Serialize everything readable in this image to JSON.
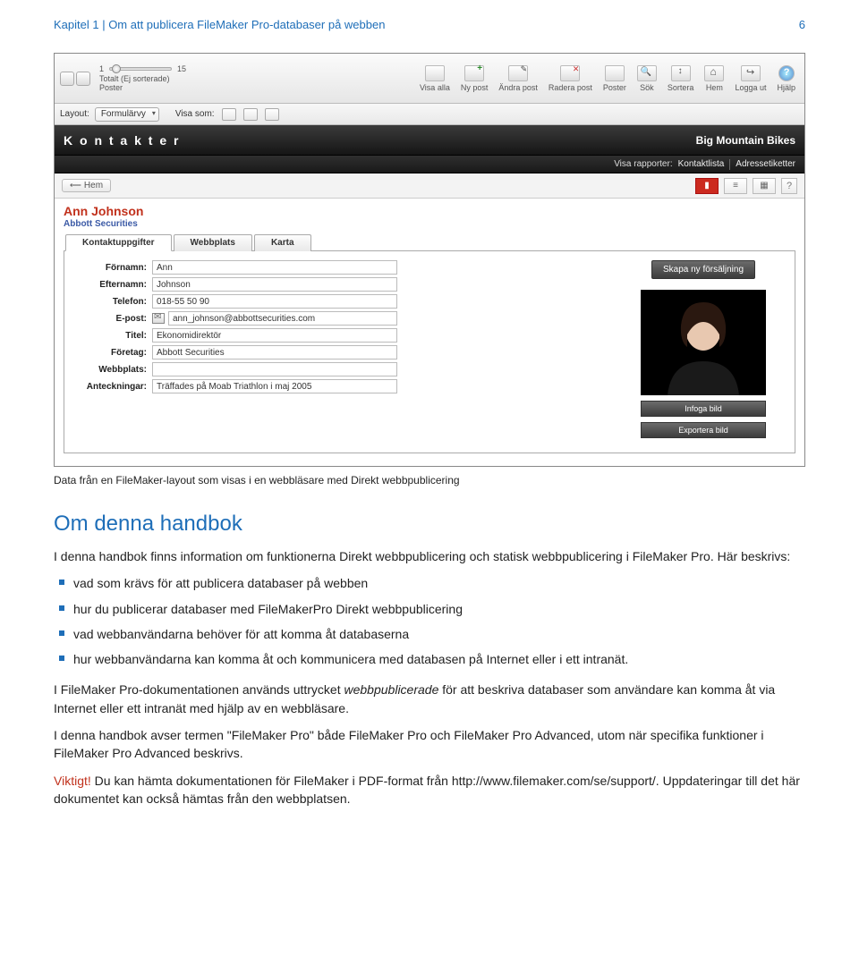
{
  "page_header": {
    "left": "Kapitel 1  |  Om att publicera FileMaker Pro-databaser på webben",
    "right": "6"
  },
  "screenshot": {
    "toolbar": {
      "record_current": "1",
      "record_total": "15",
      "sort_status": "Totalt (Ej sorterade)",
      "posts_label": "Poster",
      "actions": {
        "visa_alla": "Visa alla",
        "ny_post": "Ny post",
        "andra_post": "Ändra post",
        "radera_post": "Radera post",
        "poster": "Poster",
        "sok": "Sök",
        "sortera": "Sortera",
        "hem": "Hem",
        "logga_ut": "Logga ut",
        "hjalp": "Hjälp"
      },
      "layout_label": "Layout:",
      "layout_value": "Formulärvy",
      "visa_som_label": "Visa som:"
    },
    "blackbar": {
      "title": "K o n t a k t e r",
      "company": "Big Mountain Bikes",
      "reports_label": "Visa rapporter:",
      "report1": "Kontaktlista",
      "report2": "Adressetiketter"
    },
    "subheader": {
      "home": "Hem"
    },
    "record": {
      "name": "Ann Johnson",
      "company": "Abbott Securities",
      "tabs": {
        "kontakt": "Kontaktuppgifter",
        "webb": "Webbplats",
        "karta": "Karta"
      },
      "fields": {
        "fornamn_label": "Förnamn:",
        "fornamn": "Ann",
        "efternamn_label": "Efternamn:",
        "efternamn": "Johnson",
        "telefon_label": "Telefon:",
        "telefon": "018-55 50 90",
        "epost_label": "E-post:",
        "epost": "ann_johnson@abbottsecurities.com",
        "titel_label": "Titel:",
        "titel": "Ekonomidirektör",
        "foretag_label": "Företag:",
        "foretag": "Abbott Securities",
        "webb_label": "Webbplats:",
        "webb": "",
        "anteck_label": "Anteckningar:",
        "anteck": "Träffades på Moab Triathlon i maj 2005"
      },
      "buttons": {
        "skapa": "Skapa ny försäljning",
        "infoga": "Infoga bild",
        "export": "Exportera bild"
      }
    }
  },
  "caption": "Data från en FileMaker-layout som visas i en webbläsare med Direkt webbpublicering",
  "section_heading": "Om denna handbok",
  "para1": "I denna handbok finns information om funktionerna Direkt webbpublicering och statisk webbpublicering i FileMaker Pro. Här beskrivs:",
  "bullets": {
    "b1": "vad som krävs för att publicera databaser på webben",
    "b2": "hur du publicerar databaser med FileMakerPro Direkt webbpublicering",
    "b3": "vad webbanvändarna behöver för att komma åt databaserna",
    "b4": "hur webbanvändarna kan komma åt och kommunicera med databasen på Internet eller i ett intranät."
  },
  "para2a": "I FileMaker Pro-dokumentationen används uttrycket ",
  "para2_term": "webbpublicerade",
  "para2b": " för att beskriva databaser som användare kan komma åt via Internet eller ett intranät med hjälp av en webbläsare.",
  "para3": "I denna handbok avser termen \"FileMaker Pro\" både FileMaker Pro och FileMaker Pro Advanced, utom när specifika funktioner i FileMaker Pro Advanced beskrivs.",
  "important_label": "Viktigt!",
  "para4": "  Du kan hämta dokumentationen för FileMaker i PDF-format från http://www.filemaker.com/se/support/. Uppdateringar till det här dokumentet kan också hämtas från den webbplatsen."
}
